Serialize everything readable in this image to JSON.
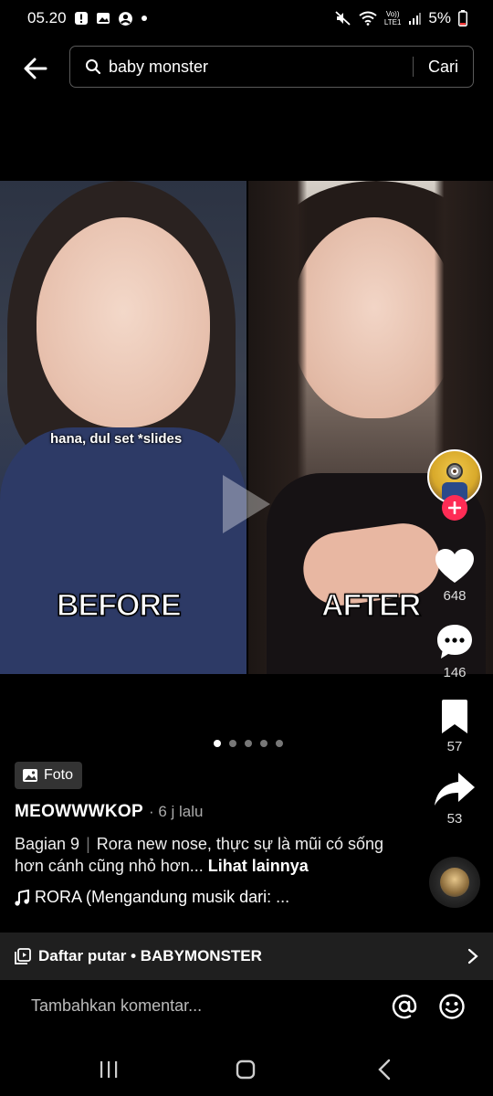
{
  "status_bar": {
    "time": "05.20",
    "battery": "5%",
    "network_label": "LTE1",
    "volte_label": "Vo))"
  },
  "search": {
    "query": "baby monster",
    "submit_label": "Cari"
  },
  "post": {
    "image_caption": "hana, dul set *slides",
    "label_before": "BEFORE",
    "label_after": "AFTER",
    "type_badge": "Foto",
    "author": "MEOWWWKOP",
    "time_ago": "· 6 j lalu",
    "description_part1": "Bagian 9",
    "description_separator": "|",
    "description_part2": "Rora new nose, thực sự là mũi có sống hơn cánh cũng nhỏ hơn...",
    "see_more": "Lihat lainnya",
    "music": "RORA (Mengandung musik dari: ...",
    "pager_total": 5,
    "pager_active": 1
  },
  "actions": {
    "likes": "648",
    "comments": "146",
    "saves": "57",
    "shares": "53"
  },
  "playlist": {
    "label": "Daftar putar • BABYMONSTER"
  },
  "comment": {
    "placeholder": "Tambahkan komentar..."
  },
  "icons": {
    "back": "back-arrow-icon",
    "search": "search-icon",
    "like": "heart-icon",
    "comment": "comment-bubble-icon",
    "save": "bookmark-icon",
    "share": "share-arrow-icon",
    "mention": "at-icon",
    "emoji": "emoji-icon",
    "playlist": "playlist-icon",
    "chevron": "chevron-right-icon"
  },
  "colors": {
    "background": "#000000",
    "follow_badge": "#fe2c55",
    "playlist_bar": "#1f1f1f"
  }
}
